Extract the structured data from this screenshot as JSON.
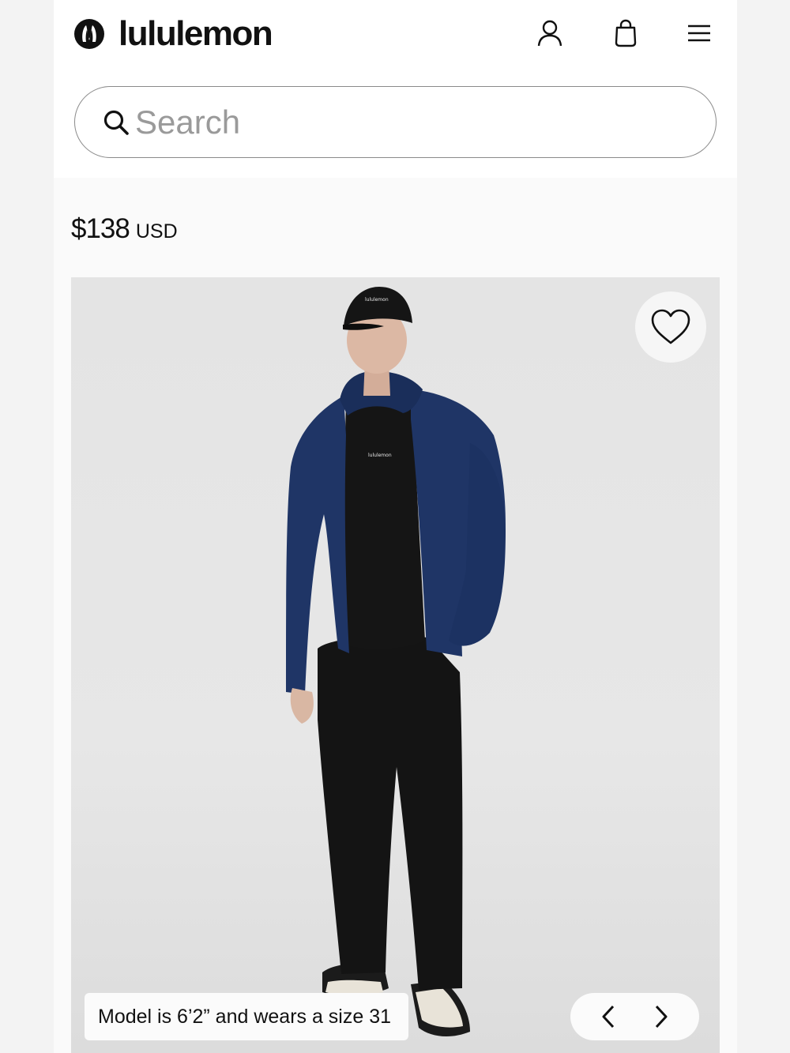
{
  "header": {
    "brand_name": "lululemon",
    "icons": [
      "lululemon-logo-icon",
      "account-icon",
      "shopping-bag-icon",
      "hamburger-menu-icon"
    ]
  },
  "search": {
    "placeholder": "Search",
    "value": ""
  },
  "product": {
    "price_amount": "$138",
    "price_currency": "USD",
    "image_caption": "Model is 6’2” and wears a size 31",
    "wishlist_icon": "heart-outline-icon",
    "carousel": {
      "prev_icon": "chevron-left-icon",
      "next_icon": "chevron-right-icon"
    }
  },
  "colors": {
    "jacket": "#1f3566",
    "background": "#e5e5e5",
    "text": "#111111"
  }
}
